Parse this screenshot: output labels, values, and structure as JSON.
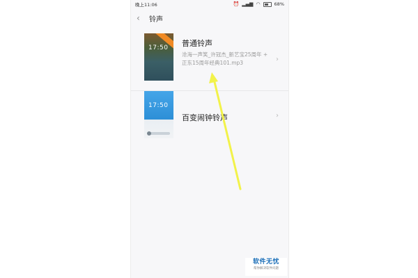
{
  "status_bar": {
    "time": "晚上11:06",
    "battery": "68%"
  },
  "header": {
    "title": "铃声"
  },
  "ringtones": [
    {
      "name": "普通铃声",
      "description": "沧海一声笑_许冠杰_新艺宝25周年 + 正东15周年经典101.mp3",
      "preview_time": "17:50"
    },
    {
      "name": "百变闹钟铃声",
      "description": "",
      "preview_time": "17:50"
    }
  ],
  "watermark": {
    "title": "软件无忧",
    "subtitle": "帮你解决软件问题"
  },
  "colors": {
    "annotation_arrow": "#f2f24a",
    "watermark_text": "#1d6fb8"
  }
}
